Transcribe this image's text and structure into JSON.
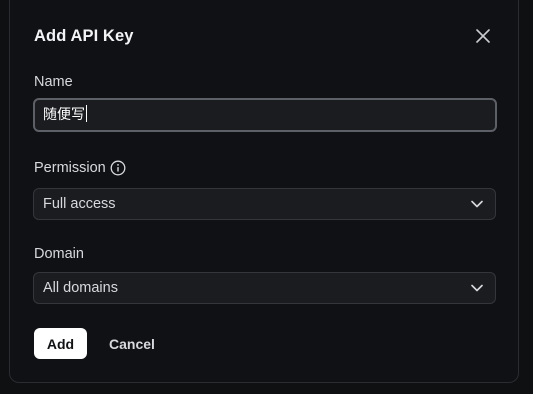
{
  "dialog": {
    "title": "Add API Key",
    "close_icon": "close-icon"
  },
  "name_field": {
    "label": "Name",
    "value": "随便写"
  },
  "permission_field": {
    "label": "Permission",
    "info_icon": "info-icon",
    "selected": "Full access",
    "chevron_icon": "chevron-down-icon"
  },
  "domain_field": {
    "label": "Domain",
    "selected": "All domains",
    "chevron_icon": "chevron-down-icon"
  },
  "actions": {
    "add_label": "Add",
    "cancel_label": "Cancel"
  },
  "colors": {
    "background": "#101114",
    "field_bg": "#1b1c20",
    "primary_button": "#ffffff",
    "text": "#d7d9de"
  }
}
